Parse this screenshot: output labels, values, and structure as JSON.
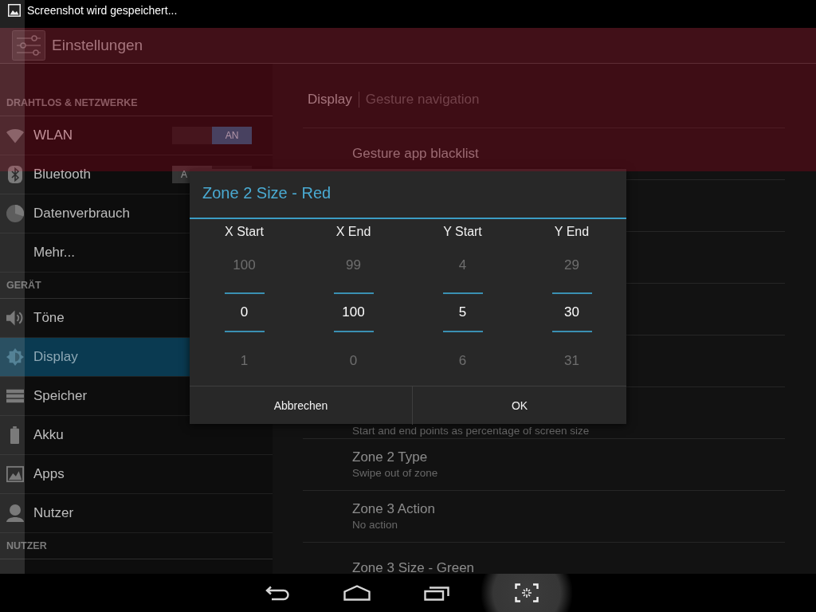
{
  "status_bar": {
    "notification": "Screenshot wird gespeichert..."
  },
  "action_bar": {
    "title": "Einstellungen"
  },
  "sidebar": {
    "sections": [
      {
        "header": "DRAHTLOS & NETZWERKE",
        "items": [
          {
            "label": "WLAN",
            "selected": false,
            "toggle": {
              "on": true,
              "label": "AN"
            }
          },
          {
            "label": "Bluetooth",
            "selected": false,
            "toggle": {
              "on": false,
              "label": "A"
            }
          },
          {
            "label": "Datenverbrauch",
            "selected": false
          },
          {
            "label": "Mehr...",
            "selected": false
          }
        ]
      },
      {
        "header": "GERÄT",
        "items": [
          {
            "label": "Töne",
            "selected": false
          },
          {
            "label": "Display",
            "selected": true
          },
          {
            "label": "Speicher",
            "selected": false
          },
          {
            "label": "Akku",
            "selected": false
          },
          {
            "label": "Apps",
            "selected": false
          },
          {
            "label": "Nutzer",
            "selected": false
          }
        ]
      },
      {
        "header": "NUTZER"
      }
    ]
  },
  "detail": {
    "breadcrumb": [
      {
        "label": "Display",
        "current": false
      },
      {
        "label": "Gesture navigation",
        "current": true
      }
    ],
    "rows": [
      {
        "title": "Gesture app blacklist"
      },
      {
        "summary": "Start and end points as percentage of screen size"
      },
      {
        "title": "Zone 2 Type",
        "summary": "Swipe out of zone"
      },
      {
        "title": "Zone 3 Action",
        "summary": "No action"
      },
      {
        "title": "Zone 3 Size - Green"
      }
    ]
  },
  "dialog": {
    "title": "Zone 2 Size - Red",
    "pickers": [
      {
        "label": "X Start",
        "previous": "100",
        "value": "0",
        "next": "1"
      },
      {
        "label": "X End",
        "previous": "99",
        "value": "100",
        "next": "0"
      },
      {
        "label": "Y Start",
        "previous": "4",
        "value": "5",
        "next": "6"
      },
      {
        "label": "Y End",
        "previous": "29",
        "value": "30",
        "next": "31"
      }
    ],
    "buttons": [
      "Abbrechen",
      "OK"
    ]
  },
  "nav_bar": {
    "buttons": [
      {
        "pressed": false
      },
      {
        "pressed": false
      },
      {
        "pressed": false
      },
      {
        "pressed": true
      }
    ]
  }
}
